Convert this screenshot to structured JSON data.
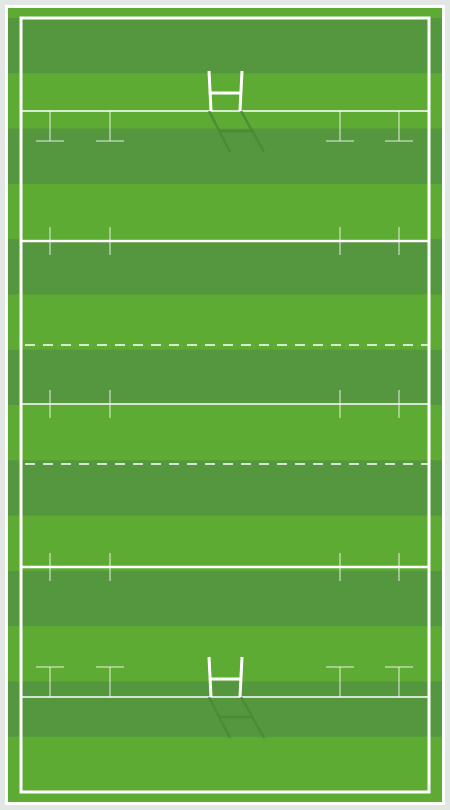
{
  "pitch": {
    "sport": "rugby",
    "orientation": "vertical",
    "stripe_count": 14,
    "colors": {
      "background": "#ffffff",
      "outer_border": "#e3e7e3",
      "stripe_light": "#5eab34",
      "stripe_dark": "#55973f",
      "lines": "#ffffff",
      "post_shadow": "#4b8a38"
    },
    "markings": {
      "try_lines": 2,
      "twenty_two_lines": 2,
      "halfway_line": 1,
      "dashed_ten_metre_lines": 2,
      "goal_posts": 2
    }
  }
}
